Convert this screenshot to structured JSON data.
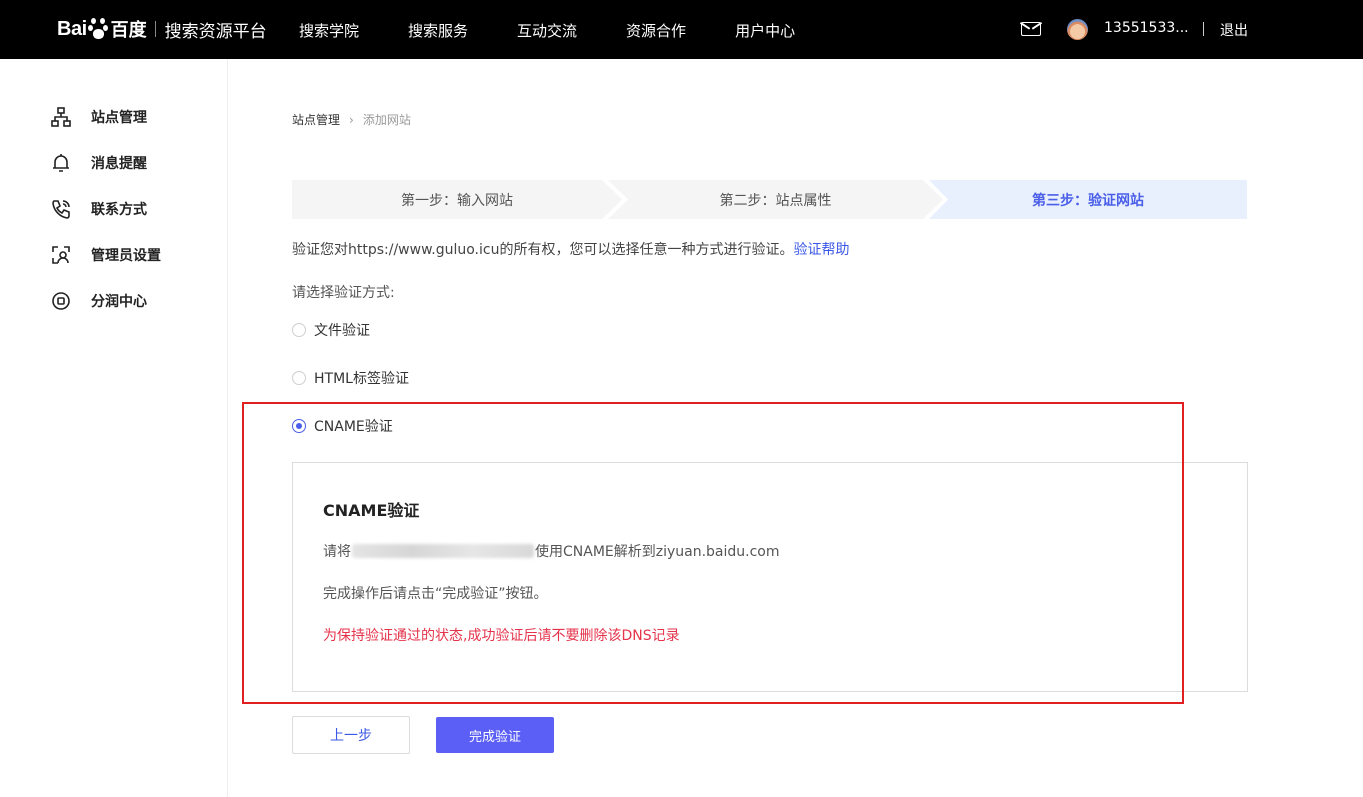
{
  "header": {
    "logo_text_bai": "Bai",
    "logo_text_du": "百度",
    "platform": "搜索资源平台",
    "nav": [
      {
        "label": "搜索学院"
      },
      {
        "label": "搜索服务"
      },
      {
        "label": "互动交流"
      },
      {
        "label": "资源合作"
      },
      {
        "label": "用户中心"
      }
    ],
    "username": "13551533...",
    "logout": "退出"
  },
  "sidebar": {
    "items": [
      {
        "label": "站点管理",
        "icon": "sitemap-icon"
      },
      {
        "label": "消息提醒",
        "icon": "bell-icon"
      },
      {
        "label": "联系方式",
        "icon": "phone-icon"
      },
      {
        "label": "管理员设置",
        "icon": "admin-icon"
      },
      {
        "label": "分润中心",
        "icon": "coin-icon"
      }
    ]
  },
  "breadcrumb": {
    "root": "站点管理",
    "current": "添加网站"
  },
  "steps": [
    {
      "label": "第一步：输入网站",
      "active": false
    },
    {
      "label": "第二步：站点属性",
      "active": false
    },
    {
      "label": "第三步：验证网站",
      "active": true
    }
  ],
  "verify": {
    "text": "验证您对https://www.guluo.icu的所有权，您可以选择任意一种方式进行验证。",
    "help_link": "验证帮助",
    "choose_label": "请选择验证方式:"
  },
  "methods": [
    {
      "label": "文件验证",
      "checked": false
    },
    {
      "label": "HTML标签验证",
      "checked": false
    },
    {
      "label": "CNAME验证",
      "checked": true
    }
  ],
  "cname": {
    "title": "CNAME验证",
    "line_prefix": "请将",
    "line_suffix": "使用CNAME解析到ziyuan.baidu.com",
    "done_text": "完成操作后请点击“完成验证”按钮。",
    "warning": "为保持验证通过的状态,成功验证后请不要删除该DNS记录"
  },
  "buttons": {
    "prev": "上一步",
    "done": "完成验证"
  },
  "colors": {
    "accent": "#4a5ee8",
    "primary_button": "#5b5ff5",
    "warning_text": "#e5334b",
    "highlight_border": "#e02020"
  }
}
